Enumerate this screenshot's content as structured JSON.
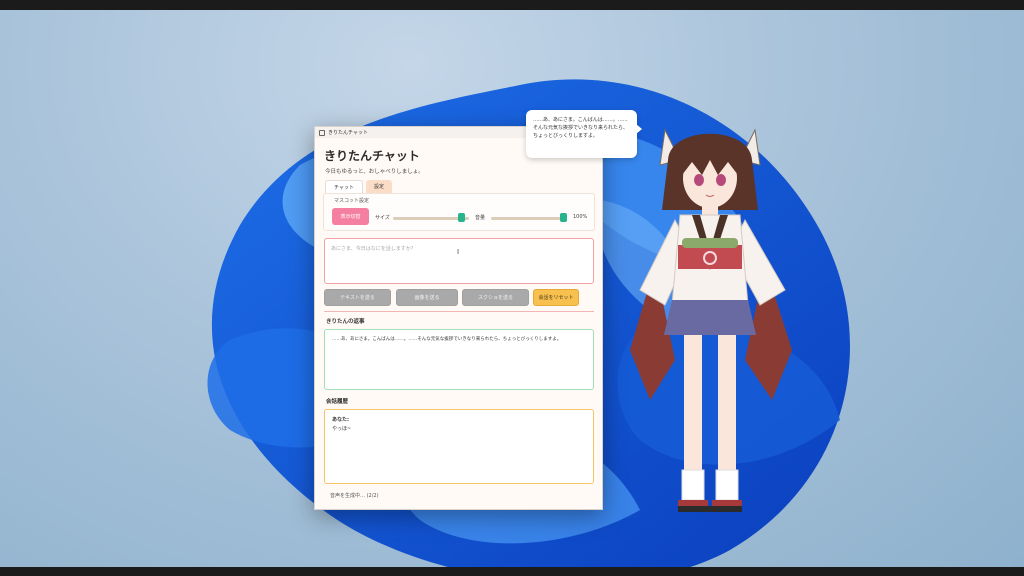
{
  "window": {
    "titlebar": "きりたんチャット",
    "title": "きりたんチャット",
    "subtitle": "今日もゆるっと、おしゃべりしましょ。"
  },
  "tabs": [
    {
      "label": "チャット",
      "active": true
    },
    {
      "label": "設定",
      "active": false
    }
  ],
  "mascot_settings": {
    "label": "マスコット設定",
    "hide_button": "表示切替",
    "size_label": "サイズ",
    "size_level": 0.95,
    "volume_label": "音量",
    "volume_level": 1.0,
    "volume_value": "100%"
  },
  "input": {
    "placeholder": "あにさま、今日はなにを話しますか？",
    "value": ""
  },
  "buttons": {
    "send_text": "テキストを送る",
    "send_image": "画像を送る",
    "send_screenshot": "スクショを送る",
    "reset": "会話をリセット"
  },
  "reply": {
    "title": "きりたんの返事",
    "text": "……あ、あにさま。こんばんは……。……そんな元気な挨拶でいきなり来られたら、ちょっとびっくりしますよ。"
  },
  "history": {
    "title": "会話履歴",
    "speaker": "あなた:",
    "message": "やっほ~"
  },
  "status": "音声を生成中… (2/2)",
  "bubble": {
    "text": "……あ、あにさま。こんばんは……。……そんな元気な挨拶でいきなり来られたら、ちょっとびっくりしますよ。"
  },
  "colors": {
    "accent_pink": "#f47f9f",
    "reset_yellow": "#f7c04f",
    "slider_green": "#27b38c",
    "reply_border": "#a2dfb7",
    "history_border": "#f5c466"
  }
}
